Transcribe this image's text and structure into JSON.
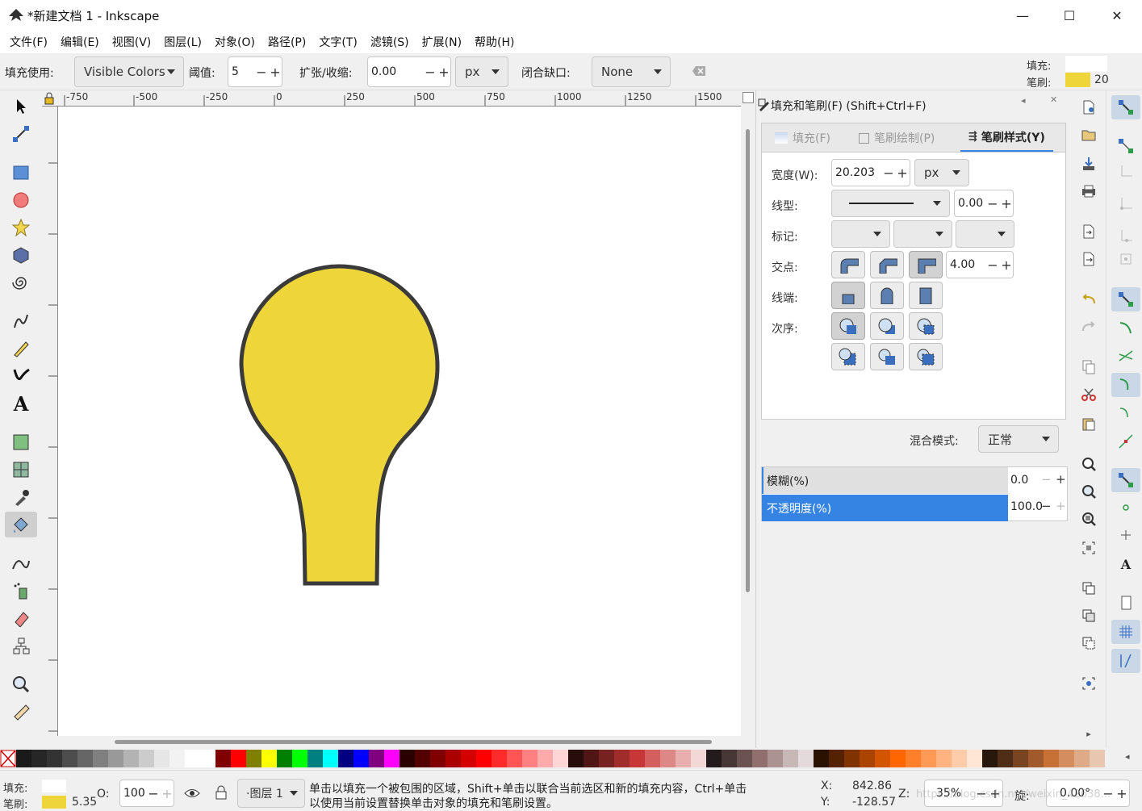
{
  "window": {
    "title": "*新建文档 1 - Inkscape",
    "minimize": "—",
    "maximize": "☐",
    "close": "✕"
  },
  "menu": [
    "文件(F)",
    "编辑(E)",
    "视图(V)",
    "图层(L)",
    "对象(O)",
    "路径(P)",
    "文字(T)",
    "滤镜(S)",
    "扩展(N)",
    "帮助(H)"
  ],
  "toolctl": {
    "fill_by_label": "填充使用:",
    "fill_by_value": "Visible Colors",
    "threshold_label": "阈值:",
    "threshold_value": "5",
    "grow_label": "扩张/收缩:",
    "grow_value": "0.00",
    "unit": "px",
    "close_gaps_label": "闭合缺口:",
    "close_gaps_value": "None",
    "style_fill_label": "填充:",
    "style_stroke_label": "笔刷:",
    "style_stroke_width": "20",
    "fill_color": "#ffffff",
    "stroke_color": "#eed53a"
  },
  "ruler": {
    "ticks": [
      "-750",
      "-500",
      "-250",
      "0",
      "250",
      "500",
      "750",
      "1000",
      "1250",
      "1500"
    ]
  },
  "canvas": {
    "shape_fill": "#eed53a",
    "shape_stroke": "#3a3a3a"
  },
  "dialog": {
    "title": "填充和笔刷(F) (Shift+Ctrl+F)",
    "tabs": [
      "填充(F)",
      "笔刷绘制(P)",
      "笔刷样式(Y)"
    ],
    "width_label": "宽度(W):",
    "width_value": "20.203",
    "width_unit": "px",
    "dash_label": "线型:",
    "dash_offset": "0.00",
    "markers_label": "标记:",
    "join_label": "交点:",
    "miter_value": "4.00",
    "cap_label": "线端:",
    "order_label": "次序:",
    "blend_label": "混合模式:",
    "blend_value": "正常",
    "blur_label": "模糊(%)",
    "blur_value": "0.0",
    "opacity_label": "不透明度(%)",
    "opacity_value": "100.0"
  },
  "status": {
    "fill_label": "填充:",
    "stroke_label": "笔刷:",
    "stroke_width": "5.35",
    "opacity_label": "O:",
    "opacity_value": "100",
    "layer": "·图层 1",
    "message_line1": "单击以填充一个被包围的区域，Shift+单击以联合当前选区和新的填充内容，Ctrl+单击",
    "message_line2": "以使用当前设置替换单击对象的填充和笔刷设置。",
    "x_label": "X:",
    "x_value": "842.86",
    "y_label": "Y:",
    "y_value": "-128.57",
    "zoom_label": "Z:",
    "zoom_value": "35%",
    "rotate_label": "旋:",
    "rotate_value": "0.00°",
    "watermark": "https://blog.csdn.net/weixin_42638..."
  },
  "palette": [
    "#1a1a1a",
    "#262626",
    "#333333",
    "#4d4d4d",
    "#666666",
    "#808080",
    "#999999",
    "#b3b3b3",
    "#cccccc",
    "#e6e6e6",
    "#f2f2f2",
    "#ffffff",
    "#ffffff",
    "#800000",
    "#ff0000",
    "#808000",
    "#ffff00",
    "#008000",
    "#00ff00",
    "#008080",
    "#00ffff",
    "#000080",
    "#0000ff",
    "#800080",
    "#ff00ff",
    "#2b0000",
    "#550000",
    "#800000",
    "#aa0000",
    "#d40000",
    "#ff0000",
    "#ff2a2a",
    "#ff5555",
    "#ff8080",
    "#ffaaaa",
    "#ffd5d5",
    "#280b0b",
    "#501616",
    "#782121",
    "#a02c2c",
    "#c83737",
    "#d35f5f",
    "#de8787",
    "#e9afaf",
    "#f4d7d7",
    "#241c1c",
    "#483737",
    "#6c5353",
    "#916f6f",
    "#ac9393",
    "#c8b7b7",
    "#e3dbdb",
    "#2b1100",
    "#552200",
    "#803300",
    "#aa4400",
    "#d45500",
    "#ff6600",
    "#ff7f2a",
    "#ff9955",
    "#ffb380",
    "#ffccaa",
    "#ffe6d5",
    "#28170b",
    "#502d16",
    "#784421",
    "#a05a2c",
    "#c87137",
    "#d38d5f",
    "#deaa87",
    "#e9c6af"
  ]
}
